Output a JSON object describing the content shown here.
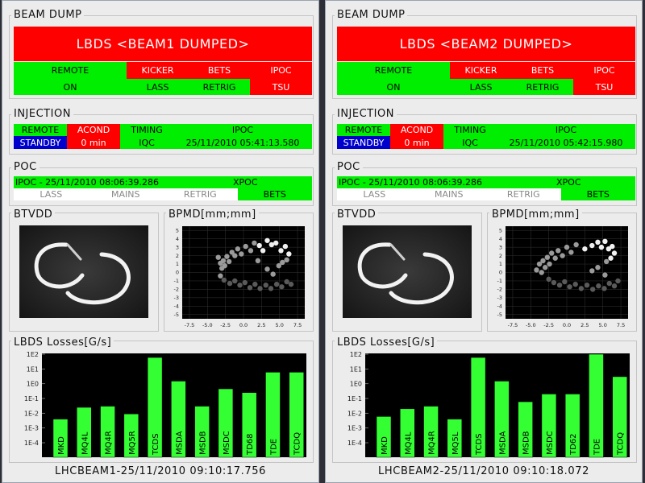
{
  "beams": [
    {
      "beam_dump": {
        "title": "BEAM DUMP",
        "banner": "LBDS <BEAM1 DUMPED>",
        "status_top": [
          "REMOTE",
          "KICKER",
          "BETS",
          "IPOC"
        ],
        "status_bottom": [
          "ON",
          "LASS",
          "RETRIG",
          "TSU"
        ]
      },
      "injection": {
        "title": "INJECTION",
        "headers": [
          "REMOTE",
          "ACOND",
          "TIMING",
          "IPOC"
        ],
        "values": [
          "STANDBY",
          "0 min",
          "IQC",
          "25/11/2010 05:41:13.580"
        ]
      },
      "poc": {
        "title": "POC",
        "ipoc": "IPOC - 25/11/2010 08:06:39.286",
        "xpoc": "XPOC",
        "items": [
          "LASS",
          "MAINS",
          "RETRIG",
          "BETS"
        ]
      },
      "btvdd": {
        "title": "BTVDD"
      },
      "bpmd": {
        "title": "BPMD[mm;mm]",
        "x_ticks": [
          "-7.5",
          "-5.0",
          "-2.5",
          "0.0",
          "2.5",
          "5.0",
          "7.5"
        ],
        "y_ticks": [
          "5",
          "4",
          "3",
          "2",
          "1",
          "0",
          "-1",
          "-2",
          "-3",
          "-4",
          "-5"
        ]
      },
      "losses": {
        "title": "LBDS Losses[G/s]",
        "y_ticks": [
          "1E2",
          "1E1",
          "1E0",
          "1E-1",
          "1E-2",
          "1E-3",
          "1E-4"
        ]
      },
      "footer": "LHCBEAM1-25/11/2010 09:10:17.756"
    },
    {
      "beam_dump": {
        "title": "BEAM DUMP",
        "banner": "LBDS <BEAM2 DUMPED>",
        "status_top": [
          "REMOTE",
          "KICKER",
          "BETS",
          "IPOC"
        ],
        "status_bottom": [
          "ON",
          "LASS",
          "RETRIG",
          "TSU"
        ]
      },
      "injection": {
        "title": "INJECTION",
        "headers": [
          "REMOTE",
          "ACOND",
          "TIMING",
          "IPOC"
        ],
        "values": [
          "STANDBY",
          "0 min",
          "IQC",
          "25/11/2010 05:42:15.980"
        ]
      },
      "poc": {
        "title": "POC",
        "ipoc": "IPOC - 25/11/2010 08:06:39.286",
        "xpoc": "XPOC",
        "items": [
          "LASS",
          "MAINS",
          "RETRIG",
          "BETS"
        ]
      },
      "btvdd": {
        "title": "BTVDD"
      },
      "bpmd": {
        "title": "BPMD[mm;mm]",
        "x_ticks": [
          "-7.5",
          "-5.0",
          "-2.5",
          "0.0",
          "2.5",
          "5.0",
          "7.5"
        ],
        "y_ticks": [
          "5",
          "4",
          "3",
          "2",
          "1",
          "0",
          "-1",
          "-2",
          "-3",
          "-4",
          "-5"
        ]
      },
      "losses": {
        "title": "LBDS Losses[G/s]",
        "y_ticks": [
          "1E2",
          "1E1",
          "1E0",
          "1E-1",
          "1E-2",
          "1E-3",
          "1E-4"
        ]
      },
      "footer": "LHCBEAM2-25/11/2010 09:10:18.072"
    }
  ],
  "colors": {
    "ok": "#00ee00",
    "alarm": "#ff0000",
    "standby": "#0000cc",
    "inactive": "#ffffff",
    "bar": "#33ff33",
    "plot_bg": "#000000"
  },
  "chart_data": [
    {
      "type": "scatter",
      "title": "BPMD[mm;mm]",
      "xlim": [
        -8.5,
        8.5
      ],
      "ylim": [
        -5.5,
        5.5
      ],
      "points": [
        [
          -3.5,
          1.8
        ],
        [
          -3.2,
          1.1
        ],
        [
          -3.0,
          0.5
        ],
        [
          -2.8,
          1.4
        ],
        [
          -2.6,
          0.8
        ],
        [
          -2.3,
          1.9
        ],
        [
          -2.0,
          1.3
        ],
        [
          -1.6,
          2.4
        ],
        [
          -1.2,
          2.0
        ],
        [
          -0.8,
          2.8
        ],
        [
          -0.3,
          2.2
        ],
        [
          0.3,
          3.1
        ],
        [
          1.0,
          2.6
        ],
        [
          1.5,
          3.5
        ],
        [
          2.2,
          3.2
        ],
        [
          2.7,
          2.6
        ],
        [
          3.3,
          3.8
        ],
        [
          3.9,
          3.3
        ],
        [
          4.5,
          3.5
        ],
        [
          5.2,
          2.6
        ],
        [
          5.8,
          3.1
        ],
        [
          6.3,
          2.2
        ],
        [
          6.0,
          1.5
        ],
        [
          5.4,
          1.2
        ],
        [
          -3.2,
          -0.4
        ],
        [
          -2.7,
          -0.9
        ],
        [
          -1.9,
          -1.3
        ],
        [
          -1.2,
          -1.0
        ],
        [
          -0.5,
          -1.5
        ],
        [
          0.2,
          -1.2
        ],
        [
          0.9,
          -1.8
        ],
        [
          1.6,
          -1.4
        ],
        [
          2.3,
          -1.9
        ],
        [
          3.1,
          -1.5
        ],
        [
          3.8,
          -1.9
        ],
        [
          4.6,
          -1.4
        ],
        [
          5.3,
          -1.7
        ],
        [
          6.0,
          -1.1
        ],
        [
          6.6,
          -1.4
        ],
        [
          2.0,
          1.4
        ],
        [
          3.3,
          0.4
        ],
        [
          4.1,
          -0.2
        ],
        [
          4.9,
          0.8
        ]
      ]
    },
    {
      "type": "bar",
      "title": "LBDS Losses[G/s]",
      "yscale": "log",
      "ylim": [
        0.0001,
        100
      ],
      "categories": [
        "MKD",
        "MQ4L",
        "MQ4R",
        "MQ5R",
        "TCDS",
        "MSDA",
        "MSDB",
        "MSDC",
        "TD68",
        "TDE",
        "TCDQ"
      ],
      "values": [
        0.004,
        0.025,
        0.03,
        0.009,
        60,
        1.5,
        0.03,
        0.45,
        0.25,
        6,
        6
      ]
    },
    {
      "type": "scatter",
      "title": "BPMD[mm;mm]",
      "xlim": [
        -8.5,
        8.5
      ],
      "ylim": [
        -5.5,
        5.5
      ],
      "points": [
        [
          -4.2,
          0.3
        ],
        [
          -3.8,
          1.0
        ],
        [
          -3.5,
          0.0
        ],
        [
          -3.3,
          1.4
        ],
        [
          -3.0,
          0.6
        ],
        [
          -2.7,
          1.8
        ],
        [
          -2.4,
          1.0
        ],
        [
          -2.1,
          2.3
        ],
        [
          -1.6,
          1.7
        ],
        [
          -1.2,
          2.6
        ],
        [
          -0.6,
          2.0
        ],
        [
          0.0,
          3.0
        ],
        [
          0.6,
          2.4
        ],
        [
          1.3,
          3.3
        ],
        [
          2.5,
          2.8
        ],
        [
          3.5,
          3.2
        ],
        [
          4.3,
          3.6
        ],
        [
          4.8,
          3.0
        ],
        [
          5.3,
          3.7
        ],
        [
          5.8,
          2.8
        ],
        [
          6.3,
          3.1
        ],
        [
          6.6,
          2.3
        ],
        [
          6.1,
          1.7
        ],
        [
          5.5,
          1.3
        ],
        [
          -2.5,
          -0.8
        ],
        [
          -1.8,
          -1.2
        ],
        [
          -1.0,
          -1.5
        ],
        [
          -0.3,
          -1.1
        ],
        [
          0.4,
          -1.7
        ],
        [
          1.2,
          -1.4
        ],
        [
          2.0,
          -1.9
        ],
        [
          2.8,
          -1.5
        ],
        [
          3.6,
          -2.0
        ],
        [
          4.4,
          -1.6
        ],
        [
          5.2,
          -1.9
        ],
        [
          5.9,
          -1.3
        ],
        [
          6.6,
          -1.6
        ],
        [
          7.1,
          -1.0
        ],
        [
          3.5,
          0.2
        ],
        [
          4.3,
          0.6
        ],
        [
          5.3,
          -0.3
        ]
      ]
    },
    {
      "type": "bar",
      "title": "LBDS Losses[G/s]",
      "yscale": "log",
      "ylim": [
        0.0001,
        100
      ],
      "categories": [
        "MKD",
        "MQ4L",
        "MQ4R",
        "MQ5L",
        "TCDS",
        "MSDA",
        "MSDB",
        "MSDC",
        "TD62",
        "TDE",
        "TCDQ"
      ],
      "values": [
        0.006,
        0.02,
        0.03,
        0.004,
        60,
        1.5,
        0.06,
        0.2,
        0.2,
        100,
        3
      ]
    }
  ]
}
